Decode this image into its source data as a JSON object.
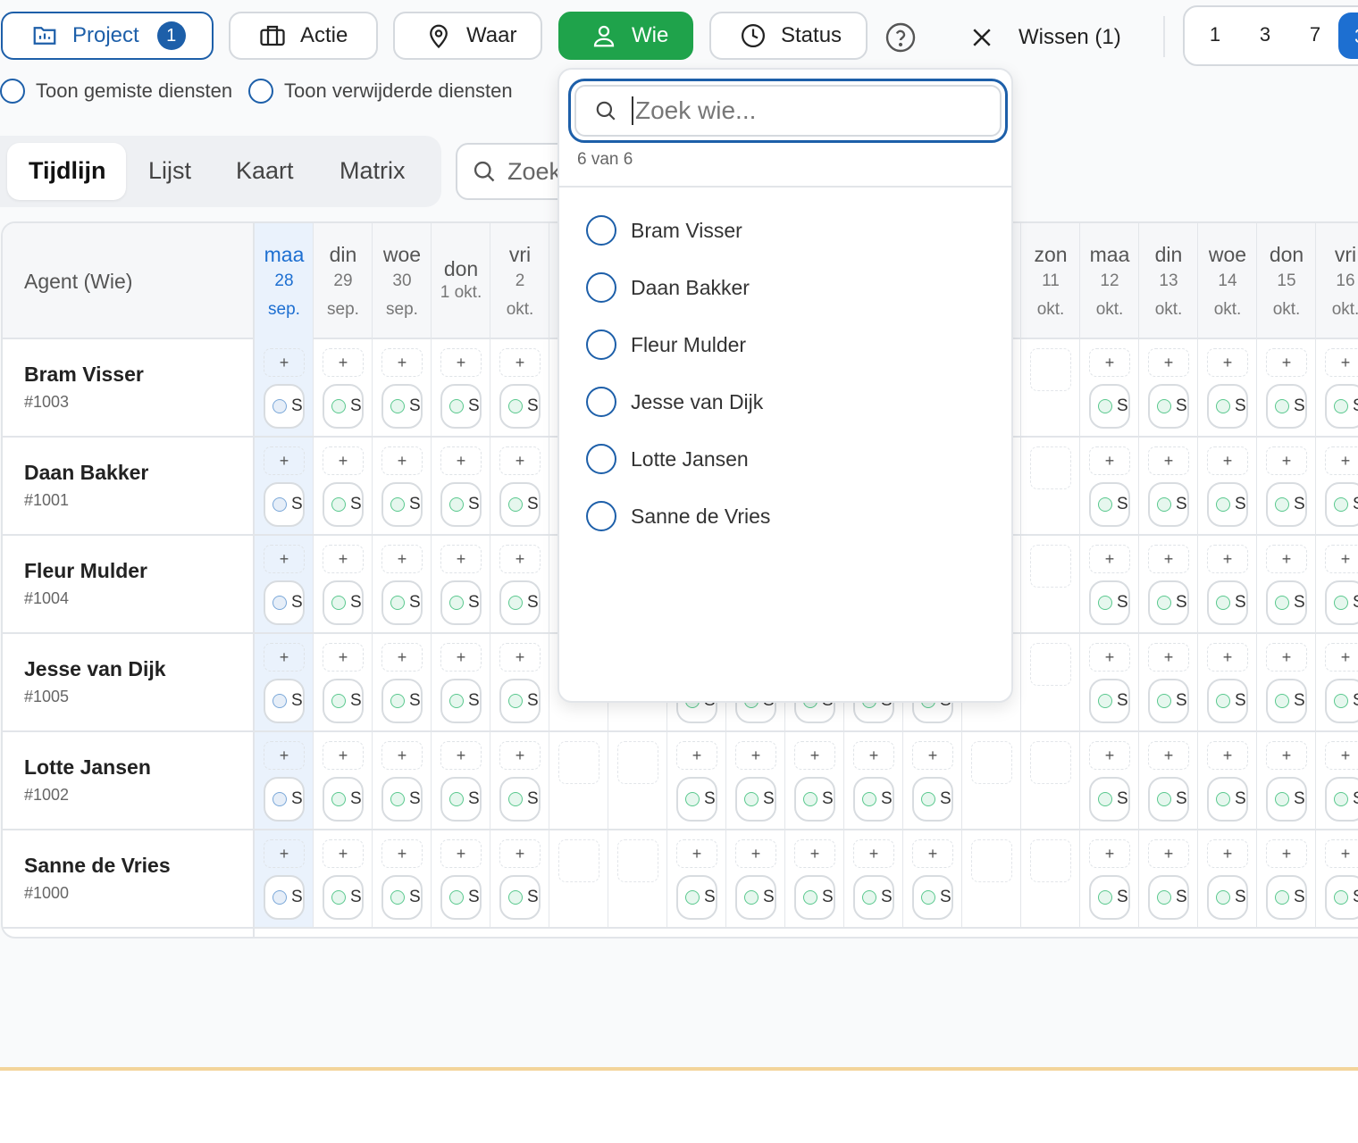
{
  "toolbar": {
    "project": {
      "label": "Project",
      "count": "1"
    },
    "actie": "Actie",
    "waar": "Waar",
    "wie": "Wie",
    "status": "Status",
    "clear": "Wissen (1)",
    "ranges": [
      "1",
      "3",
      "7"
    ],
    "range_active": "3"
  },
  "toggles": {
    "missed": "Toon gemiste diensten",
    "deleted": "Toon verwijderde diensten"
  },
  "tabs": [
    "Tijdlijn",
    "Lijst",
    "Kaart",
    "Matrix"
  ],
  "search": {
    "placeholder": "Zoek"
  },
  "grid": {
    "agent_header": "Agent (Wie)",
    "days": [
      {
        "wd": "maa",
        "dn": "28",
        "mo": "sep."
      },
      {
        "wd": "din",
        "dn": "29",
        "mo": "sep."
      },
      {
        "wd": "woe",
        "dn": "30",
        "mo": "sep."
      },
      {
        "wd": "don",
        "dn": "1 okt.",
        "mo": ""
      },
      {
        "wd": "vri",
        "dn": "2",
        "mo": "okt."
      },
      {
        "wd": "",
        "dn": "",
        "mo": ""
      },
      {
        "wd": "",
        "dn": "",
        "mo": ""
      },
      {
        "wd": "",
        "dn": "",
        "mo": ""
      },
      {
        "wd": "",
        "dn": "",
        "mo": ""
      },
      {
        "wd": "",
        "dn": "",
        "mo": ""
      },
      {
        "wd": "",
        "dn": "",
        "mo": ""
      },
      {
        "wd": "",
        "dn": "",
        "mo": ""
      },
      {
        "wd": "",
        "dn": "",
        "mo": ""
      },
      {
        "wd": "zon",
        "dn": "11",
        "mo": "okt."
      },
      {
        "wd": "maa",
        "dn": "12",
        "mo": "okt."
      },
      {
        "wd": "din",
        "dn": "13",
        "mo": "okt."
      },
      {
        "wd": "woe",
        "dn": "14",
        "mo": "okt."
      },
      {
        "wd": "don",
        "dn": "15",
        "mo": "okt."
      },
      {
        "wd": "vri",
        "dn": "16",
        "mo": "okt."
      }
    ],
    "agents": [
      {
        "name": "Bram Visser",
        "id": "#1003"
      },
      {
        "name": "Daan Bakker",
        "id": "#1001"
      },
      {
        "name": "Fleur Mulder",
        "id": "#1004"
      },
      {
        "name": "Jesse van Dijk",
        "id": "#1005"
      },
      {
        "name": "Lotte Jansen",
        "id": "#1002"
      },
      {
        "name": "Sanne de Vries",
        "id": "#1000"
      }
    ],
    "plus_label": "+",
    "pill_glyph": "S"
  },
  "dropdown": {
    "placeholder": "Zoek wie...",
    "count": "6 van 6",
    "items": [
      "Bram Visser",
      "Daan Bakker",
      "Fleur Mulder",
      "Jesse van Dijk",
      "Lotte Jansen",
      "Sanne de Vries"
    ]
  },
  "colors": {
    "primary": "#1d5fa9",
    "active_green": "#1fa34b",
    "today_bg": "#eaf2fc",
    "range_active": "#1d6fd1"
  }
}
